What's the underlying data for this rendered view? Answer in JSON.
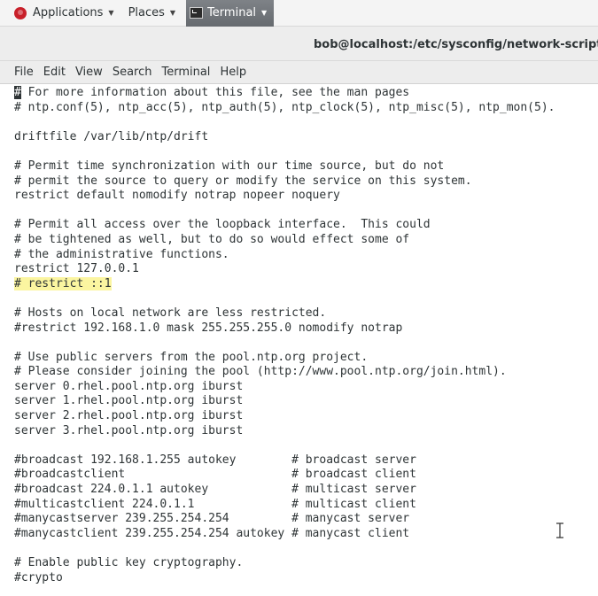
{
  "topbar": {
    "applications_label": "Applications",
    "places_label": "Places",
    "terminal_label": "Terminal",
    "caret": "▼"
  },
  "window": {
    "title": "bob@localhost:/etc/sysconfig/network-scripts"
  },
  "menu": {
    "items": [
      "File",
      "Edit",
      "View",
      "Search",
      "Terminal",
      "Help"
    ]
  },
  "terminal": {
    "cursor_char": "#",
    "highlight_line_index": 13,
    "lines": [
      "# For more information about this file, see the man pages",
      "# ntp.conf(5), ntp_acc(5), ntp_auth(5), ntp_clock(5), ntp_misc(5), ntp_mon(5).",
      "",
      "driftfile /var/lib/ntp/drift",
      "",
      "# Permit time synchronization with our time source, but do not",
      "# permit the source to query or modify the service on this system.",
      "restrict default nomodify notrap nopeer noquery",
      "",
      "# Permit all access over the loopback interface.  This could",
      "# be tightened as well, but to do so would effect some of",
      "# the administrative functions.",
      "restrict 127.0.0.1",
      "# restrict ::1",
      "",
      "# Hosts on local network are less restricted.",
      "#restrict 192.168.1.0 mask 255.255.255.0 nomodify notrap",
      "",
      "# Use public servers from the pool.ntp.org project.",
      "# Please consider joining the pool (http://www.pool.ntp.org/join.html).",
      "server 0.rhel.pool.ntp.org iburst",
      "server 1.rhel.pool.ntp.org iburst",
      "server 2.rhel.pool.ntp.org iburst",
      "server 3.rhel.pool.ntp.org iburst",
      "",
      "#broadcast 192.168.1.255 autokey        # broadcast server",
      "#broadcastclient                        # broadcast client",
      "#broadcast 224.0.1.1 autokey            # multicast server",
      "#multicastclient 224.0.1.1              # multicast client",
      "#manycastserver 239.255.254.254         # manycast server",
      "#manycastclient 239.255.254.254 autokey # manycast client",
      "",
      "# Enable public key cryptography.",
      "#crypto"
    ]
  },
  "colors": {
    "highlight": "#fbf5a0",
    "terminal_tab": "#6f7378",
    "app_icon": "#c8202a"
  }
}
